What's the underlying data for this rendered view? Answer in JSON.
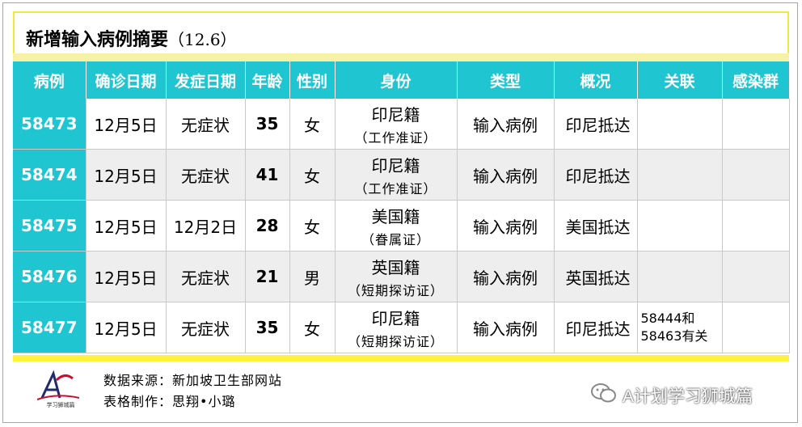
{
  "title": {
    "main": "新增输入病例摘要",
    "sub": "（12.6）"
  },
  "table": {
    "headers": [
      "病例",
      "确诊日期",
      "发症日期",
      "年龄",
      "性别",
      "身份",
      "类型",
      "概况",
      "关联",
      "感染群"
    ],
    "rows": [
      {
        "id": "58473",
        "confirm": "12月5日",
        "onset": "无症状",
        "age": "35",
        "sex": "女",
        "identity": "印尼籍",
        "identity_sub": "（工作准证）",
        "type": "输入病例",
        "summary": "印尼抵达",
        "link": "",
        "cluster": ""
      },
      {
        "id": "58474",
        "confirm": "12月5日",
        "onset": "无症状",
        "age": "41",
        "sex": "女",
        "identity": "印尼籍",
        "identity_sub": "（工作准证）",
        "type": "输入病例",
        "summary": "印尼抵达",
        "link": "",
        "cluster": ""
      },
      {
        "id": "58475",
        "confirm": "12月5日",
        "onset": "12月2日",
        "age": "28",
        "sex": "女",
        "identity": "美国籍",
        "identity_sub": "（眷属证）",
        "type": "输入病例",
        "summary": "美国抵达",
        "link": "",
        "cluster": ""
      },
      {
        "id": "58476",
        "confirm": "12月5日",
        "onset": "无症状",
        "age": "21",
        "sex": "男",
        "identity": "英国籍",
        "identity_sub": "（短期探访证）",
        "type": "输入病例",
        "summary": "英国抵达",
        "link": "",
        "cluster": ""
      },
      {
        "id": "58477",
        "confirm": "12月5日",
        "onset": "无症状",
        "age": "35",
        "sex": "女",
        "identity": "印尼籍",
        "identity_sub": "（短期探访证）",
        "type": "输入病例",
        "summary": "印尼抵达",
        "link": "58444和58463有关",
        "cluster": ""
      }
    ]
  },
  "footer": {
    "source": "数据来源：新加坡卫生部网站",
    "made_by": "表格制作：思翔•小璐",
    "wechat": "A计划学习狮城篇",
    "logo_text": "学习狮城篇"
  }
}
